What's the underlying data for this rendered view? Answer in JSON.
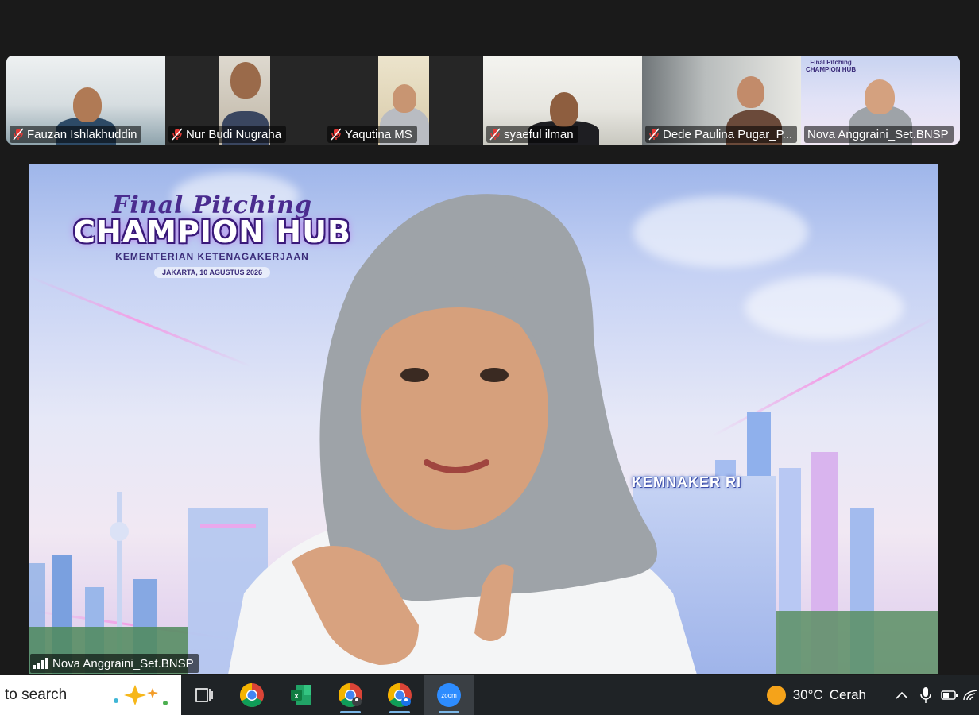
{
  "participants": [
    {
      "name": "Fauzan Ishlakhuddin",
      "muted": true
    },
    {
      "name": "Nur Budi Nugraha",
      "muted": true
    },
    {
      "name": "Yaqutina MS",
      "muted": true
    },
    {
      "name": "syaeful ilman",
      "muted": true
    },
    {
      "name": "Dede Paulina Pugar_P...",
      "muted": true
    },
    {
      "name": "Nova Anggraini_Set.BNSP",
      "muted": false
    }
  ],
  "speaker": {
    "name": "Nova Anggraini_Set.BNSP"
  },
  "background": {
    "script_title": "Final Pitching",
    "main_title": "CHAMPION HUB",
    "organization": "KEMENTERIAN KETENAGAKERJAAN",
    "date": "JAKARTA, 10 AGUSTUS 2026",
    "building_sign": "KEMNAKER RI"
  },
  "taskbar": {
    "search_text": "to search",
    "apps": [
      "task-view-icon",
      "chrome-icon",
      "excel-icon",
      "chrome-profile-icon",
      "chrome-profile-icon",
      "zoom-icon"
    ],
    "zoom_label": "zoom",
    "weather": {
      "temp": "30°C",
      "condition": "Cerah"
    }
  },
  "colors": {
    "accent": "#2d8cff",
    "mute_red": "#e53935",
    "taskbar": "#1f2326",
    "title_purple": "#4a2c8f"
  }
}
